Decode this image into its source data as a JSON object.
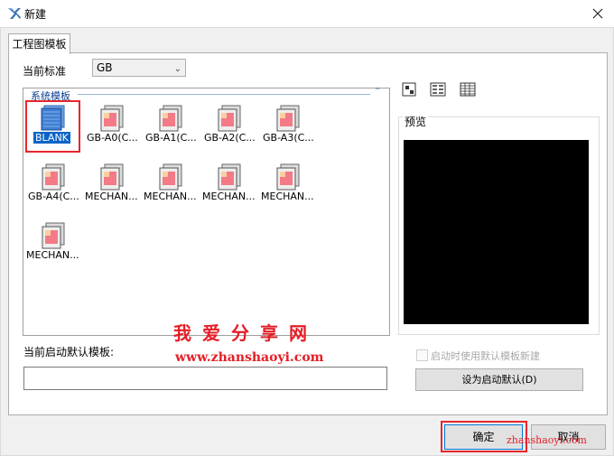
{
  "window": {
    "title": "新建"
  },
  "tabs": [
    {
      "label": "工程图模板"
    }
  ],
  "standard": {
    "label": "当前标准",
    "value": "GB"
  },
  "templates": {
    "group_title": "系统模板",
    "items": [
      {
        "label": "BLANK",
        "selected": true
      },
      {
        "label": "GB-A0(C..."
      },
      {
        "label": "GB-A1(C..."
      },
      {
        "label": "GB-A2(C..."
      },
      {
        "label": "GB-A3(C..."
      },
      {
        "label": "GB-A4(C..."
      },
      {
        "label": "MECHAN..."
      },
      {
        "label": "MECHAN..."
      },
      {
        "label": "MECHAN..."
      },
      {
        "label": "MECHAN..."
      },
      {
        "label": "MECHAN..."
      }
    ]
  },
  "view_modes": [
    "large-icons-icon",
    "list-icon",
    "details-icon"
  ],
  "preview": {
    "label": "预览"
  },
  "startup": {
    "label": "当前启动默认模板:",
    "value": ""
  },
  "startup_checkbox": {
    "label": "启动时使用默认模板新建",
    "checked": false,
    "enabled": false
  },
  "buttons": {
    "set_default": "设为启动默认(D)",
    "ok": "确定",
    "cancel": "取消"
  },
  "watermark": {
    "cn": "我爱分享网",
    "url": "www.zhanshaoyi.com",
    "url2": "zhanshaoyi.com"
  },
  "colors": {
    "accent": "#0078d7",
    "highlight": "#e8262d",
    "selection": "#0a64c8"
  }
}
